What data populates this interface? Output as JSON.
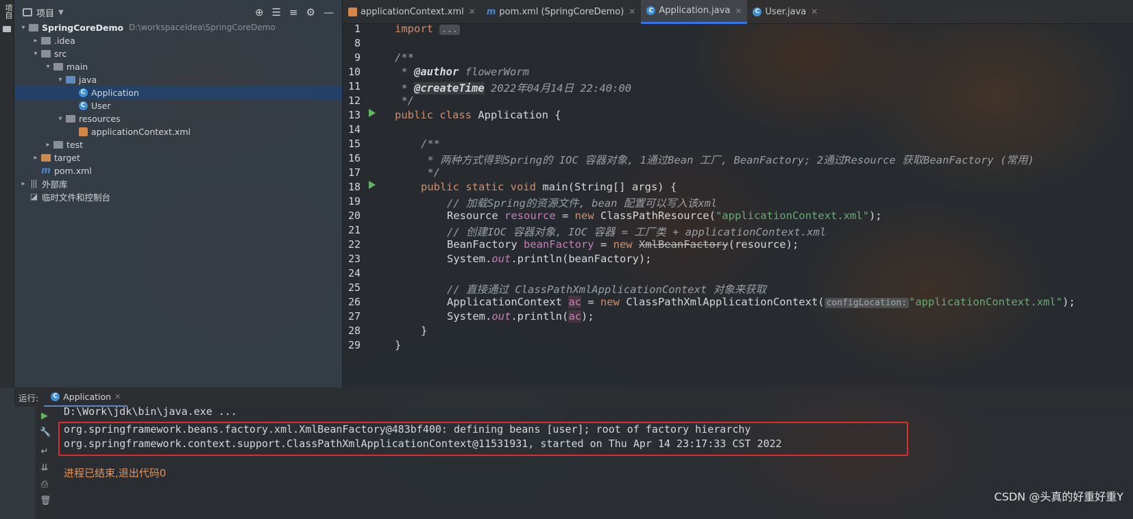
{
  "toolstrip": {
    "project_tab": "项目"
  },
  "project": {
    "title": "项目",
    "tree": [
      {
        "label": "SpringCoreDemo",
        "path": "D:\\workspaceIdea\\SpringCoreDemo"
      },
      {
        "label": ".idea"
      },
      {
        "label": "src"
      },
      {
        "label": "main"
      },
      {
        "label": "java"
      },
      {
        "label": "Application"
      },
      {
        "label": "User"
      },
      {
        "label": "resources"
      },
      {
        "label": "applicationContext.xml"
      },
      {
        "label": "test"
      },
      {
        "label": "target"
      },
      {
        "label": "pom.xml"
      },
      {
        "label": "外部库"
      },
      {
        "label": "临时文件和控制台"
      }
    ]
  },
  "tabs": [
    {
      "label": "applicationContext.xml"
    },
    {
      "label": "pom.xml (SpringCoreDemo)"
    },
    {
      "label": "Application.java"
    },
    {
      "label": "User.java"
    }
  ],
  "editor": {
    "line_numbers": [
      "1",
      "8",
      "9",
      "10",
      "11",
      "12",
      "13",
      "14",
      "15",
      "16",
      "17",
      "18",
      "19",
      "20",
      "21",
      "22",
      "23",
      "24",
      "25",
      "26",
      "27",
      "28",
      "29"
    ],
    "code": {
      "l1_import": "import",
      "l1_fold": "...",
      "l8": "/**",
      "l9_star": " * ",
      "l9_tag": "@author",
      "l9_text": " flowerWorm",
      "l10_star": " * ",
      "l10_tag": "@createTime",
      "l10_text": " 2022年04月14日 22:40:00",
      "l11": " */",
      "l12_kw": "public class",
      "l12_name": " Application {",
      "l14": "/**",
      "l15": " * 两种方式得到Spring的 IOC 容器对象, 1通过Bean 工厂, BeanFactory; 2通过Resource 获取BeanFactory (常用)",
      "l16": " */",
      "l17_kw": "public static void",
      "l17_rest": " main(String[] args) {",
      "l18": "// 加载Spring的资源文件, bean 配置可以写入该xml",
      "l19_type": "Resource ",
      "l19_var": "resource",
      "l19_mid": " = ",
      "l19_new": "new",
      "l19_cls": " ClassPathResource(",
      "l19_str": "\"applicationContext.xml\"",
      "l19_end": ");",
      "l20": "// 创建IOC 容器对象, IOC 容器 = 工厂类 + applicationContext.xml",
      "l21_type": "BeanFactory ",
      "l21_var": "beanFactory",
      "l21_mid": " = ",
      "l21_new": "new",
      "l21_sp": " ",
      "l21_cls": "XmlBeanFactory",
      "l21_end": "(resource);",
      "l22_sys": "System.",
      "l22_out": "out",
      "l22_rest": ".println(beanFactory);",
      "l24": "// 直接通过 ClassPathXmlApplicationContext 对象来获取",
      "l25_type": "ApplicationContext ",
      "l25_var": "ac",
      "l25_mid": " = ",
      "l25_new": "new",
      "l25_cls": " ClassPathXmlApplicationContext(",
      "l25_hint": "configLocation:",
      "l25_str": "\"applicationContext.xml\"",
      "l25_end": ");",
      "l26_sys": "System.",
      "l26_out": "out",
      "l26_rest": ".println(",
      "l26_var": "ac",
      "l26_end": ");",
      "l27": "}",
      "l28": "}"
    }
  },
  "run": {
    "label": "运行:",
    "tab": "Application",
    "console": [
      "D:\\Work\\jdk\\bin\\java.exe ...",
      "org.springframework.beans.factory.xml.XmlBeanFactory@483bf400: defining beans [user]; root of factory hierarchy",
      "org.springframework.context.support.ClassPathXmlApplicationContext@11531931, started on Thu Apr 14 23:17:33 CST 2022",
      "进程已结束,退出代码0"
    ]
  },
  "watermark": "CSDN @头真的好重好重Y"
}
